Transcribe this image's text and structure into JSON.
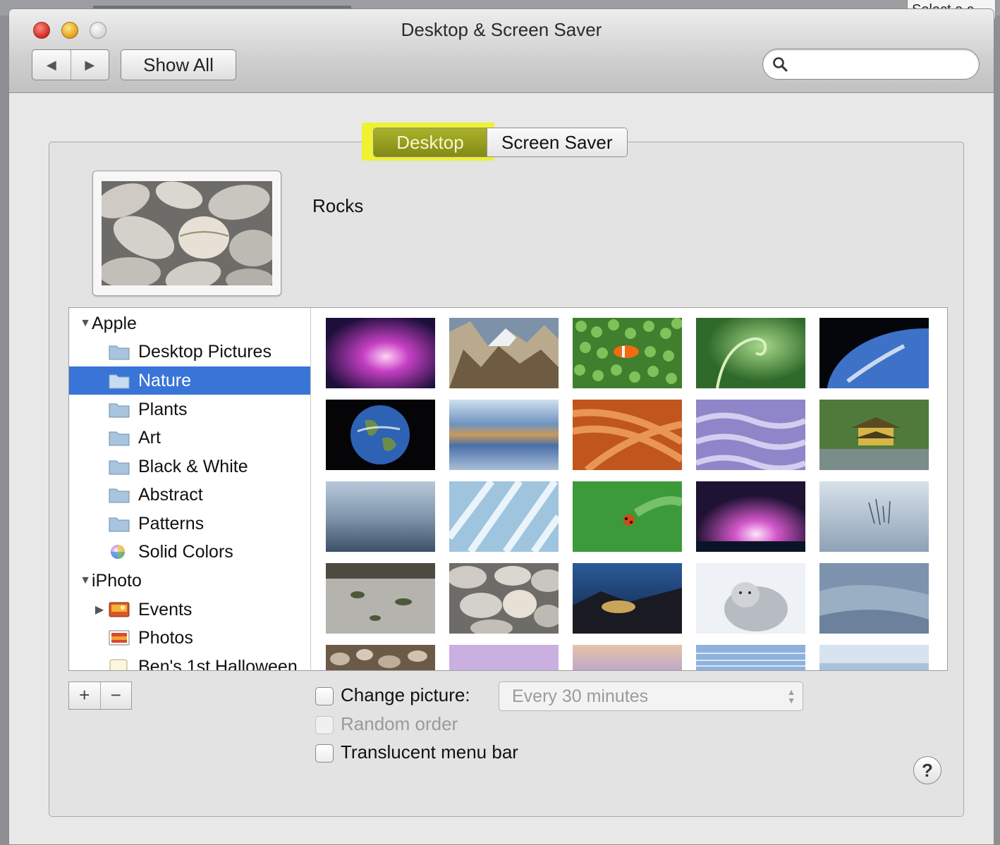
{
  "background_window": {
    "title_fragment": "Select a c"
  },
  "window": {
    "title": "Desktop & Screen Saver",
    "toolbar": {
      "back_label": "◀",
      "forward_label": "▶",
      "show_all_label": "Show All"
    },
    "search": {
      "placeholder": "",
      "icon": "search-icon"
    }
  },
  "tabs": [
    {
      "label": "Desktop",
      "active": true,
      "highlighted": true
    },
    {
      "label": "Screen Saver",
      "active": false
    }
  ],
  "preview": {
    "picture_name": "Rocks"
  },
  "sidebar": {
    "groups": [
      {
        "label": "Apple",
        "expanded": true,
        "items": [
          {
            "label": "Desktop Pictures",
            "icon": "folder-icon",
            "selected": false
          },
          {
            "label": "Nature",
            "icon": "folder-icon",
            "selected": true
          },
          {
            "label": "Plants",
            "icon": "folder-icon",
            "selected": false
          },
          {
            "label": "Art",
            "icon": "folder-icon",
            "selected": false
          },
          {
            "label": "Black & White",
            "icon": "folder-icon",
            "selected": false
          },
          {
            "label": "Abstract",
            "icon": "folder-icon",
            "selected": false
          },
          {
            "label": "Patterns",
            "icon": "folder-icon",
            "selected": false
          },
          {
            "label": "Solid Colors",
            "icon": "color-wheel-icon",
            "selected": false
          }
        ]
      },
      {
        "label": "iPhoto",
        "expanded": true,
        "items": [
          {
            "label": "Events",
            "icon": "iphoto-events-icon",
            "collapsed": true
          },
          {
            "label": "Photos",
            "icon": "iphoto-photos-icon"
          },
          {
            "label": "Ben's 1st Halloween",
            "icon": "album-icon"
          }
        ]
      }
    ],
    "add_label": "+",
    "remove_label": "−"
  },
  "options": {
    "change_picture": {
      "label": "Change picture:",
      "checked": false
    },
    "interval": {
      "value": "Every 30 minutes",
      "enabled": false
    },
    "random_order": {
      "label": "Random order",
      "checked": false,
      "enabled": false
    },
    "translucent_menu_bar": {
      "label": "Translucent menu bar",
      "checked": false
    }
  },
  "help_label": "?",
  "colors": {
    "selection": "#3875d7",
    "tab_active": "#838a18",
    "highlight": "#eef230"
  }
}
